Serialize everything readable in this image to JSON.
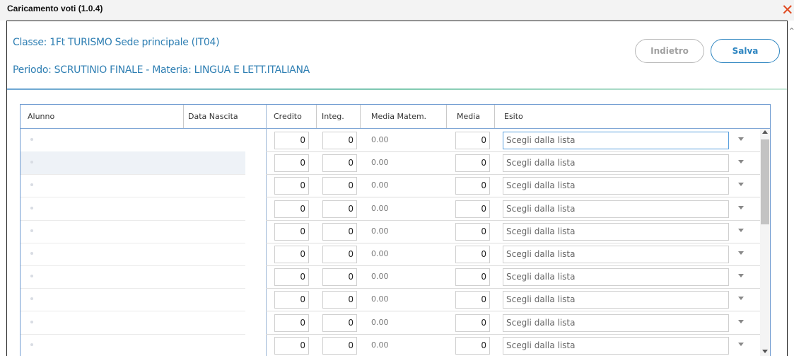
{
  "window": {
    "title": "Caricamento voti (1.0.4)",
    "close_icon": "close-icon"
  },
  "header": {
    "classe": "Classe: 1Ft TURISMO Sede principale (IT04)",
    "periodo": "Periodo: SCRUTINIO FINALE - Materia: LINGUA E LETT.ITALIANA"
  },
  "buttons": {
    "back_label": "Indietro",
    "save_label": "Salva"
  },
  "table": {
    "columns": [
      "Alunno",
      "Data Nascita",
      "Credito",
      "Integ.",
      "Media Matem.",
      "Media",
      "Esito"
    ],
    "rows": [
      {
        "credito": "0",
        "integ": "0",
        "media_matem": "0.00",
        "media": "0",
        "esito": "Scegli dalla lista"
      },
      {
        "credito": "0",
        "integ": "0",
        "media_matem": "0.00",
        "media": "0",
        "esito": "Scegli dalla lista"
      },
      {
        "credito": "0",
        "integ": "0",
        "media_matem": "0.00",
        "media": "0",
        "esito": "Scegli dalla lista"
      },
      {
        "credito": "0",
        "integ": "0",
        "media_matem": "0.00",
        "media": "0",
        "esito": "Scegli dalla lista"
      },
      {
        "credito": "0",
        "integ": "0",
        "media_matem": "0.00",
        "media": "0",
        "esito": "Scegli dalla lista"
      },
      {
        "credito": "0",
        "integ": "0",
        "media_matem": "0.00",
        "media": "0",
        "esito": "Scegli dalla lista"
      },
      {
        "credito": "0",
        "integ": "0",
        "media_matem": "0.00",
        "media": "0",
        "esito": "Scegli dalla lista"
      },
      {
        "credito": "0",
        "integ": "0",
        "media_matem": "0.00",
        "media": "0",
        "esito": "Scegli dalla lista"
      },
      {
        "credito": "0",
        "integ": "0",
        "media_matem": "0.00",
        "media": "0",
        "esito": "Scegli dalla lista"
      },
      {
        "credito": "0",
        "integ": "0",
        "media_matem": "0.00",
        "media": "0",
        "esito": "Scegli dalla lista"
      }
    ]
  },
  "colors": {
    "accent": "#2f86c1",
    "close": "#e04a20",
    "header_text": "#2f7fb3"
  }
}
